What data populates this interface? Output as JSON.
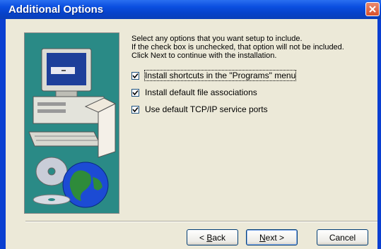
{
  "window": {
    "title": "Additional Options"
  },
  "intro": {
    "line1": "Select any options that you want setup to include.",
    "line2": "If the check box is unchecked, that option will not be included.",
    "line3": "Click Next to continue with the installation."
  },
  "options": [
    {
      "label": "Install shortcuts in the \"Programs\" menu",
      "checked": true
    },
    {
      "label": "Install default file associations",
      "checked": true
    },
    {
      "label": "Use default TCP/IP service ports",
      "checked": true
    }
  ],
  "buttons": {
    "back": {
      "mnemonic": "B",
      "rest": "ack",
      "prefix": "< "
    },
    "next": {
      "mnemonic": "N",
      "rest": "ext >"
    },
    "cancel": "Cancel"
  }
}
